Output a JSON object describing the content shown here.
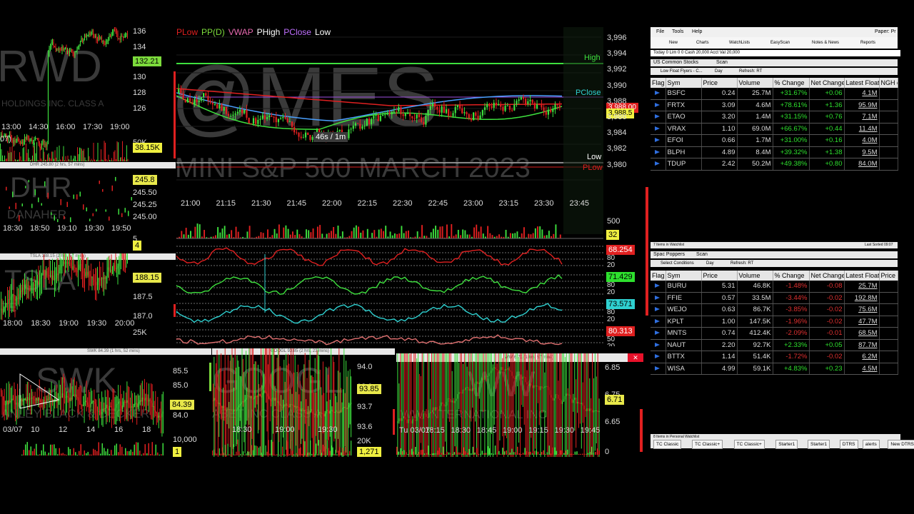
{
  "main": {
    "symbol_watermark": "@MES",
    "desc_watermark": "MINI S&P 500 MARCH 2023",
    "indicators": [
      "PLow",
      "PP(D)",
      "VWAP",
      "PHigh",
      "PClose",
      "Low"
    ],
    "indicator_colors": [
      "#e02020",
      "#7ddc3c",
      "#e86ab0",
      "#ffffff",
      "#c070ff",
      "#ffffff"
    ],
    "price_ticks": [
      "3,996",
      "3,994",
      "3,992",
      "3,990",
      "3,988",
      "3,986",
      "3,984",
      "3,982",
      "3,980"
    ],
    "time_ticks": [
      "21:00",
      "21:15",
      "21:30",
      "21:45",
      "22:00",
      "22:15",
      "22:30",
      "22:45",
      "23:00",
      "23:15",
      "23:30",
      "23:45"
    ],
    "last_price_tag": "3,988.5",
    "last_price_tag2": "3,988.00",
    "level_labels": {
      "high": "High",
      "pclose": "PClose",
      "low": "Low",
      "plow": "PLow"
    },
    "interval_label": "46s / 1m",
    "volume_tick": "500",
    "volume_tag": "32",
    "osc_tags": [
      "68.254",
      "71.429",
      "73.571",
      "80.313"
    ],
    "osc_tag_colors": [
      "#e02020",
      "#2ee02e",
      "#2fd0d0",
      "#e02020"
    ],
    "osc_ticks": [
      [
        "80",
        "20"
      ],
      [
        "80",
        "20"
      ],
      [
        "80",
        "20"
      ],
      [
        "50",
        "20"
      ]
    ]
  },
  "left_panels": [
    {
      "watermark": "RWD",
      "desc": "HOLDINGS INC. CLASS A",
      "ticks": [
        "136",
        "134",
        "130",
        "128",
        "126"
      ],
      "tag": "132.21",
      "tag_color": "#7ddc3c",
      "times": [
        "13:00",
        "14:30",
        "16:00",
        "17:30",
        "19:00"
      ],
      "vol_tag": "38.15K",
      "vol_tick": "50K",
      "left_label": "07)"
    },
    {
      "watermark": "DHR",
      "desc": "DANAHER",
      "ticks": [
        "245.50",
        "245.25",
        "245.00"
      ],
      "tag": "245.8",
      "tag_color": "#e8e84a",
      "times": [
        "18:30",
        "18:50",
        "19:10",
        "19:30",
        "19:50"
      ],
      "vol_tag": "4",
      "vol_tick": "5",
      "title": "DHR 245.80 (2 hrs, 57 mins)"
    },
    {
      "watermark": "TSLA",
      "desc": "TE",
      "ticks": [
        "187.5",
        "187.0"
      ],
      "tag": "188.15",
      "tag_color": "#e8e84a",
      "times": [
        "18:00",
        "18:30",
        "19:00",
        "19:30",
        "20:00"
      ],
      "vol_tick": "25K",
      "title": "TSLA 188.15 (2 hrs, 57 mins)"
    }
  ],
  "bottom_panels": [
    {
      "watermark": "SWK",
      "desc": "ANLEY BLACK & DECKER",
      "ticks": [
        "85.5",
        "85.0",
        "84.0"
      ],
      "tag": "84.39",
      "tag_color": "#e8e84a",
      "times": [
        "03/07",
        "10",
        "12",
        "14",
        "16",
        "18"
      ],
      "vol_tick": "10,000",
      "vol_tag": "1",
      "title": "SWK 84.39 (1 hrs, 52 mins)"
    },
    {
      "watermark": "GOOGL",
      "desc": "ABET INC CLASS A",
      "ticks": [
        "94.0",
        "93.9",
        "93.7",
        "93.6"
      ],
      "tag": "93.85",
      "tag_color": "#e8e84a",
      "times": [
        "18:30",
        "19:00",
        "19:30"
      ],
      "vol_tick": "20K",
      "vol_tag": "1,271",
      "title": "GOOGL 93.85 (2 hrs, 23 mins)"
    },
    {
      "watermark": "WW",
      "desc": "WW INTERNATIONAL INC",
      "ticks": [
        "6.85",
        "6.75",
        "6.65"
      ],
      "tag": "6.71",
      "tag_color": "#e8e84a",
      "times": [
        "Tu 03/07",
        "18:15",
        "18:30",
        "18:45",
        "19:00",
        "19:15",
        "19:30",
        "19:45"
      ],
      "vol_tick": "0",
      "title": "WW 6.71 (1 hrs, 57 mins)"
    }
  ],
  "scanner": {
    "menu": [
      "File",
      "Tools",
      "Help"
    ],
    "paper_label": "Paper: Pr",
    "toolbar": [
      "New",
      "Charts",
      "WatchLists",
      "EasyScan",
      "Notes & News",
      "Reports"
    ],
    "account_strip": "Today 0  Lim 0 0  Cash 20,000  Acct Val 20,000",
    "section1": {
      "title": "US Common Stocks",
      "scan": "Scan",
      "filter": "Low Float Flyers - C...",
      "period": "Day",
      "refresh": "Refresh: RT"
    },
    "columns": [
      "Flag",
      "Sym",
      "Price",
      "Volume",
      "% Change",
      "Net Change",
      "Latest Float",
      "NGH of"
    ],
    "rows1": [
      {
        "sym": "BSFC",
        "price": "0.24",
        "volume": "25.7M",
        "pct": "+31.67%",
        "net": "+0.06",
        "float": "4.1M",
        "dir": "pos"
      },
      {
        "sym": "FRTX",
        "price": "3.09",
        "volume": "4.6M",
        "pct": "+78.61%",
        "net": "+1.36",
        "float": "95.9M",
        "dir": "pos"
      },
      {
        "sym": "ETAO",
        "price": "3.20",
        "volume": "1.4M",
        "pct": "+31.15%",
        "net": "+0.76",
        "float": "7.1M",
        "dir": "pos"
      },
      {
        "sym": "VRAX",
        "price": "1.10",
        "volume": "69.0M",
        "pct": "+66.67%",
        "net": "+0.44",
        "float": "11.4M",
        "dir": "pos"
      },
      {
        "sym": "EFOI",
        "price": "0.66",
        "volume": "1.7M",
        "pct": "+31.00%",
        "net": "+0.16",
        "float": "4.0M",
        "dir": "pos"
      },
      {
        "sym": "BLPH",
        "price": "4.89",
        "volume": "8.4M",
        "pct": "+39.32%",
        "net": "+1.38",
        "float": "9.5M",
        "dir": "pos"
      },
      {
        "sym": "TDUP",
        "price": "2.42",
        "volume": "50.2M",
        "pct": "+49.38%",
        "net": "+0.80",
        "float": "84.0M",
        "dir": "pos"
      }
    ],
    "footer1": "7 Items in Watchlist",
    "footer1_right": "Last Sorted 09:07",
    "section2": {
      "title": "Spac Poppers",
      "scan": "Scan",
      "filter": "Select Conditions",
      "period": "Day",
      "refresh": "Refresh: RT"
    },
    "columns2": [
      "Flag",
      "Sym",
      "Price",
      "Volume",
      "% Change",
      "Net Change",
      "Latest Float",
      "Price Ov"
    ],
    "rows2": [
      {
        "sym": "BURU",
        "price": "5.31",
        "volume": "46.8K",
        "pct": "-1.48%",
        "net": "-0.08",
        "float": "25.7M",
        "dir": "neg"
      },
      {
        "sym": "FFIE",
        "price": "0.57",
        "volume": "33.5M",
        "pct": "-3.44%",
        "net": "-0.02",
        "float": "192.8M",
        "dir": "neg"
      },
      {
        "sym": "WEJO",
        "price": "0.63",
        "volume": "86.7K",
        "pct": "-3.85%",
        "net": "-0.02",
        "float": "75.6M",
        "dir": "neg"
      },
      {
        "sym": "KPLT",
        "price": "1.00",
        "volume": "147.5K",
        "pct": "-1.96%",
        "net": "-0.02",
        "float": "47.7M",
        "dir": "neg"
      },
      {
        "sym": "MNTS",
        "price": "0.74",
        "volume": "412.4K",
        "pct": "-2.09%",
        "net": "-0.01",
        "float": "68.5M",
        "dir": "neg"
      },
      {
        "sym": "NAUT",
        "price": "2.20",
        "volume": "92.7K",
        "pct": "+2.33%",
        "net": "+0.05",
        "float": "87.7M",
        "dir": "pos"
      },
      {
        "sym": "BTTX",
        "price": "1.14",
        "volume": "51.4K",
        "pct": "-1.72%",
        "net": "-0.02",
        "float": "6.2M",
        "dir": "neg"
      },
      {
        "sym": "WISA",
        "price": "4.99",
        "volume": "59.1K",
        "pct": "+4.83%",
        "net": "+0.23",
        "float": "4.5M",
        "dir": "pos"
      }
    ],
    "footer2": "8 Items in Personal Watchlist",
    "tabs": [
      "TC Classic",
      "TC Classic+",
      "TC Classic+",
      "Starter1",
      "Starter1",
      "DTRS",
      "alerts",
      "New DTRS Info",
      "Spac Po"
    ]
  }
}
